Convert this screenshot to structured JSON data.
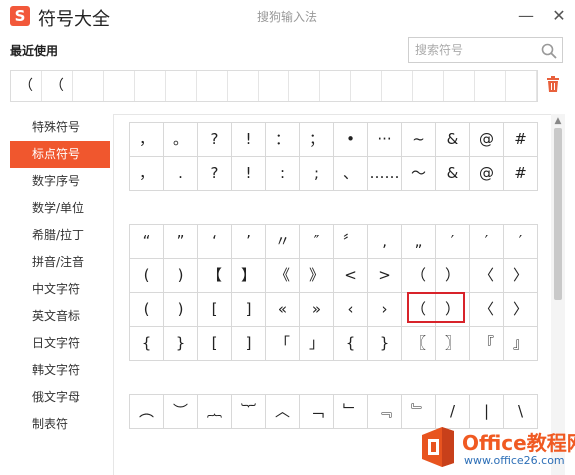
{
  "titlebar": {
    "logo_text": "S",
    "title": "符号大全",
    "ime_name": "搜狗输入法",
    "minimize_glyph": "—",
    "close_glyph": "✕"
  },
  "recent": {
    "label": "最近使用",
    "items": [
      "（",
      "（",
      "",
      "",
      "",
      "",
      "",
      "",
      "",
      "",
      "",
      "",
      "",
      "",
      "",
      "",
      ""
    ]
  },
  "search": {
    "placeholder": "搜索符号",
    "value": ""
  },
  "categories": [
    {
      "label": "特殊符号",
      "active": false
    },
    {
      "label": "标点符号",
      "active": true
    },
    {
      "label": "数字序号",
      "active": false
    },
    {
      "label": "数学/单位",
      "active": false
    },
    {
      "label": "希腊/拉丁",
      "active": false
    },
    {
      "label": "拼音/注音",
      "active": false
    },
    {
      "label": "中文字符",
      "active": false
    },
    {
      "label": "英文音标",
      "active": false
    },
    {
      "label": "日文字符",
      "active": false
    },
    {
      "label": "韩文字符",
      "active": false
    },
    {
      "label": "俄文字母",
      "active": false
    },
    {
      "label": "制表符",
      "active": false
    }
  ],
  "symbol_groups": [
    {
      "rows": [
        [
          "，",
          "。",
          "?",
          "!",
          "：",
          "；",
          "•",
          "···",
          "~",
          "&",
          "@",
          "#"
        ],
        [
          "，",
          ".",
          "?",
          "!",
          ":",
          ";",
          "、",
          "……",
          "～",
          "&",
          "@",
          "#"
        ]
      ]
    },
    {
      "rows": [
        [
          "“",
          "”",
          "‘",
          "’",
          "〃",
          "″",
          "〞",
          "‚",
          "„",
          "′",
          "′",
          "′"
        ],
        [
          "(",
          ")",
          "【",
          "】",
          "《",
          "》",
          "<",
          ">",
          "（",
          "）",
          "〈",
          "〉"
        ],
        [
          "(",
          ")",
          "[",
          "]",
          "«",
          "»",
          "‹",
          "›",
          "（",
          "）",
          "〈",
          "〉"
        ],
        [
          "{",
          "}",
          "[",
          "]",
          "「",
          "」",
          "{",
          "}",
          "〖",
          "〗",
          "『",
          "』"
        ]
      ]
    },
    {
      "rows": [
        [
          "︵",
          "︶",
          "︷",
          "︸",
          "︿",
          "﹁",
          "﹂",
          "﹃",
          "﹄",
          "/",
          "|",
          "\\"
        ]
      ]
    }
  ],
  "watermark": {
    "title": "Office教程网",
    "url": "www.office26.com"
  },
  "colors": {
    "accent": "#f0572e",
    "highlight": "#d8232a",
    "watermark_orange": "#f05a22",
    "watermark_blue": "#2d6fb7"
  }
}
